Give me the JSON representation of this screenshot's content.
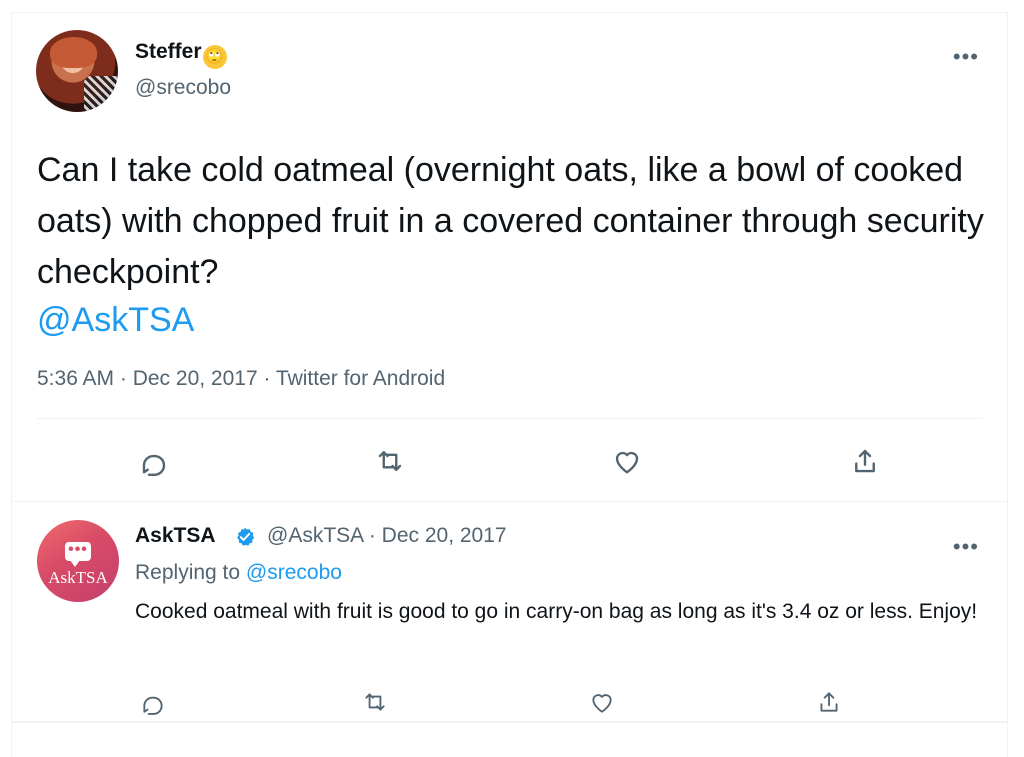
{
  "main_tweet": {
    "display_name": "Steffer",
    "name_emoji": "🙄",
    "handle": "@srecobo",
    "more_label": "•••",
    "body": "Can I take cold oatmeal (overnight oats, like a bowl of cooked oats) with chopped fruit in a covered container through security checkpoint?",
    "mention": "@AskTSA",
    "meta": "5:36 AM · Dec 20, 2017 · Twitter for Android",
    "actions": [
      "reply-icon",
      "retweet-icon",
      "like-icon",
      "share-icon"
    ]
  },
  "reply_tweet": {
    "avatar_text": "AskTSA",
    "display_name": "AskTSA",
    "handle_date": "@AskTSA · Dec 20, 2017",
    "more_label": "•••",
    "replying_prefix": "Replying to ",
    "replying_handle": "@srecobo",
    "body": "Cooked oatmeal with fruit is good to go in carry-on bag as long as it's 3.4 oz or less. Enjoy!",
    "actions": [
      "reply-icon",
      "retweet-icon",
      "like-icon",
      "share-icon"
    ]
  },
  "colors": {
    "accent": "#1d9bf0",
    "secondary_text": "#536471",
    "primary_text": "#0f1419"
  }
}
